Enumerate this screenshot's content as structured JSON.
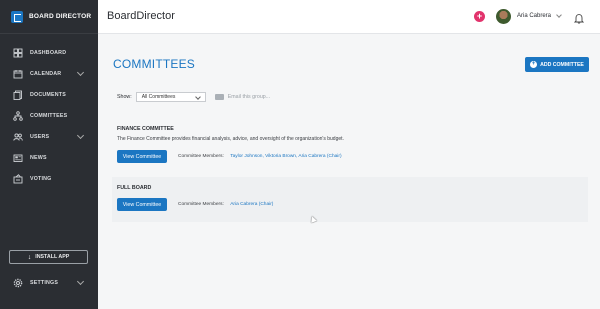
{
  "app": {
    "brand": "BOARD DIRECTOR",
    "title": "BoardDirector"
  },
  "sidebar": {
    "items": [
      {
        "label": "DASHBOARD",
        "icon": "dashboard-icon"
      },
      {
        "label": "CALENDAR",
        "icon": "calendar-icon"
      },
      {
        "label": "DOCUMENTS",
        "icon": "documents-icon"
      },
      {
        "label": "COMMITTEES",
        "icon": "committees-icon"
      },
      {
        "label": "USERS",
        "icon": "users-icon"
      },
      {
        "label": "NEWS",
        "icon": "news-icon"
      },
      {
        "label": "VOTING",
        "icon": "voting-icon"
      }
    ],
    "install_label": "INSTALL APP",
    "settings_label": "SETTINGS"
  },
  "user": {
    "name": "Aria Cabrera"
  },
  "main": {
    "title": "COMMITTEES",
    "add_label": "ADD COMMITTEE",
    "filter": {
      "show_label": "Show:",
      "selected": "All Committees",
      "email_label": "Email this group..."
    },
    "committees": [
      {
        "name": "FINANCE COMMITTEE",
        "description": "The Finance Committee provides financial analysis, advice, and oversight of the organization's budget.",
        "view_label": "View Committee",
        "members_label": "Committee Members:",
        "members": "Taylor Johnson, Viktoria Brown, Aria Cabrera (Chair)"
      },
      {
        "name": "FULL BOARD",
        "view_label": "View Committee",
        "members_label": "Committee Members:",
        "members": "Aria Cabrera (Chair)"
      }
    ]
  },
  "colors": {
    "accent": "#1b76c2",
    "sidebar": "#2b2e33",
    "notify": "#e2336c"
  }
}
